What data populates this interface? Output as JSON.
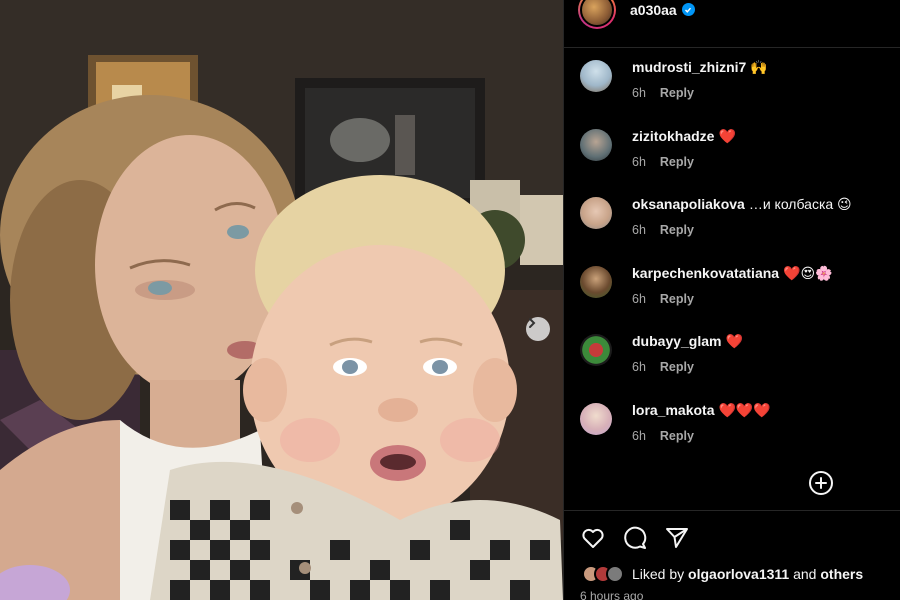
{
  "post": {
    "author": "a030aa",
    "verified": true,
    "time_ago": "6 hours ago"
  },
  "comments": [
    {
      "username": "mudrosti_zhizni7",
      "text": "🙌",
      "time": "6h",
      "reply": "Reply",
      "avatar_color": "#9fb7c9"
    },
    {
      "username": "zizitokhadze",
      "text": "❤️",
      "time": "6h",
      "reply": "Reply",
      "avatar_color": "#5f6f74"
    },
    {
      "username": "oksanapoliakova",
      "text": "…и колбаска 😉",
      "time": "6h",
      "reply": "Reply",
      "avatar_color": "#c9a48a"
    },
    {
      "username": "karpechenkovatatiana",
      "text": "❤️😍🌸",
      "time": "6h",
      "reply": "Reply",
      "avatar_color": "#6b4a2f"
    },
    {
      "username": "dubayy_glam",
      "text": "❤️",
      "time": "6h",
      "reply": "Reply",
      "avatar_color": "#3c8a3a"
    },
    {
      "username": "lora_makota",
      "text": "❤️❤️❤️",
      "time": "6h",
      "reply": "Reply",
      "avatar_color": "#d7b0b8"
    }
  ],
  "likes": {
    "prefix": "Liked by",
    "user": "olgaorlova1311",
    "conjunction": "and",
    "others": "others"
  },
  "icons": {
    "next": "chevron-right-icon",
    "add": "add-circle-icon",
    "like": "heart-icon",
    "comment": "comment-icon",
    "share": "send-icon"
  },
  "colors": {
    "background": "#000000",
    "verified": "#0095f6",
    "muted": "#a8a8a8"
  }
}
